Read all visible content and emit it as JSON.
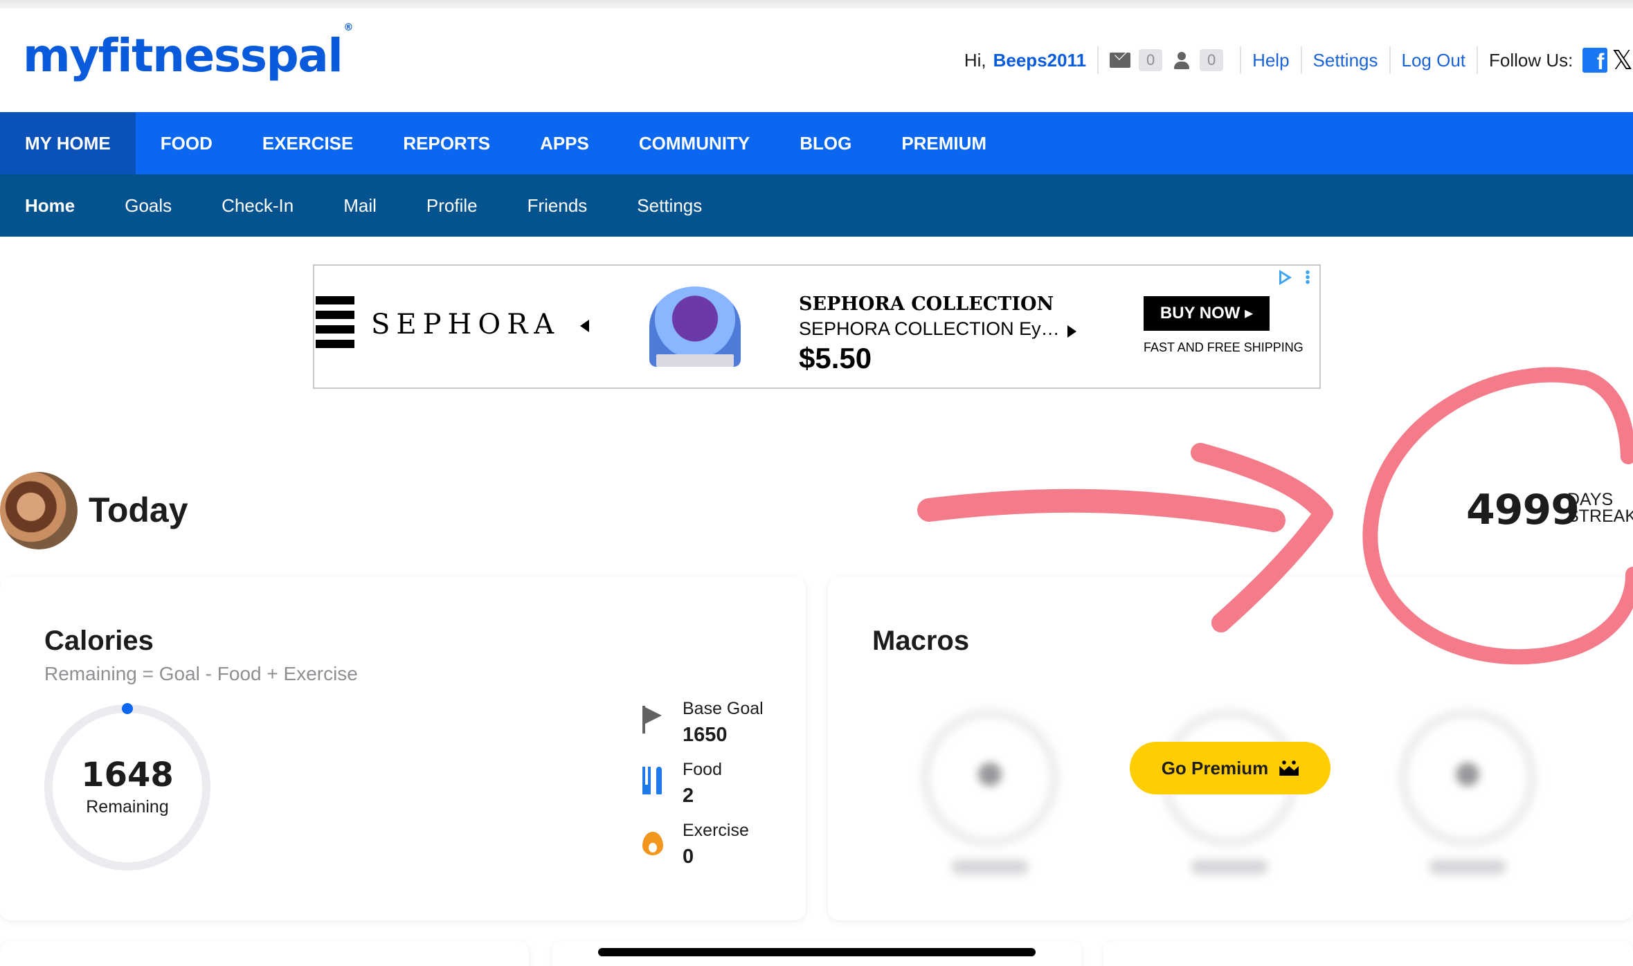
{
  "header": {
    "logo": "myfitnesspal",
    "logo_mark": "®",
    "greeting": "Hi,",
    "username": "Beeps2011",
    "mail_count": "0",
    "friend_requests_count": "0",
    "help": "Help",
    "settings": "Settings",
    "logout": "Log Out",
    "follow_us": "Follow Us:",
    "facebook_icon": "f",
    "x_icon": "𝕏"
  },
  "main_nav": [
    "MY HOME",
    "FOOD",
    "EXERCISE",
    "REPORTS",
    "APPS",
    "COMMUNITY",
    "BLOG",
    "PREMIUM"
  ],
  "sub_nav": [
    "Home",
    "Goals",
    "Check-In",
    "Mail",
    "Profile",
    "Friends",
    "Settings"
  ],
  "ad": {
    "brand": "SEPHORA",
    "product_title": "SEPHORA COLLECTION",
    "product_subtitle": "SEPHORA COLLECTION Ey…",
    "price": "$5.50",
    "cta": "BUY NOW ▸",
    "shipping": "FAST AND FREE SHIPPING"
  },
  "today": {
    "title": "Today",
    "streak_value": "4999",
    "streak_label_line1": "DAYS",
    "streak_label_line2": "STREAK"
  },
  "calories": {
    "title": "Calories",
    "formula": "Remaining = Goal - Food + Exercise",
    "remaining_value": "1648",
    "remaining_label": "Remaining",
    "remaining_fraction": 0.9988,
    "stats": [
      {
        "label": "Base Goal",
        "value": "1650",
        "icon": "flag-icon"
      },
      {
        "label": "Food",
        "value": "2",
        "icon": "fork-knife-icon"
      },
      {
        "label": "Exercise",
        "value": "0",
        "icon": "fire-icon"
      }
    ]
  },
  "macros": {
    "title": "Macros",
    "go_premium": "Go Premium",
    "blurred_columns": [
      {
        "color": "#8fd6b8"
      },
      {
        "color": "#b59ad8"
      },
      {
        "color": "#f3c58a"
      }
    ]
  },
  "colors": {
    "brand_blue": "#0b66f0",
    "subnav_blue": "#04538f",
    "premium_yellow": "#ffcd00",
    "annotation_red": "#f2697a"
  }
}
